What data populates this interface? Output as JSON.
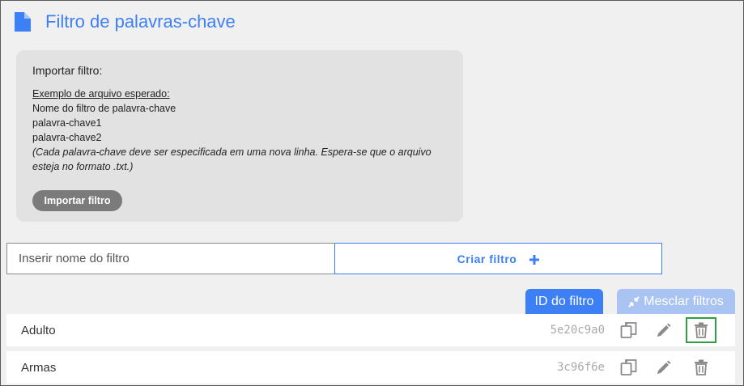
{
  "header": {
    "title": "Filtro de palavras-chave",
    "icon": "document-icon"
  },
  "import_box": {
    "label": "Importar filtro:",
    "example_title": "Exemplo de arquivo esperado:",
    "example_lines": [
      "Nome do filtro de palavra-chave",
      "palavra-chave1",
      "palavra-chave2"
    ],
    "note": "(Cada palavra-chave deve ser especificada em uma nova linha. Espera-se que o arquivo esteja no formato .txt.)",
    "button_label": "Importar filtro"
  },
  "create": {
    "input_placeholder": "Inserir nome do filtro",
    "input_value": "",
    "button_label": "Criar filtro",
    "button_icon": "plus-icon"
  },
  "tabs": {
    "filter_id_label": "ID do filtro",
    "merge_label": "Mesclar filtros",
    "merge_icon": "merge-arrows-icon"
  },
  "filters": [
    {
      "name": "Adulto",
      "id": "5e20c9a0"
    },
    {
      "name": "Armas",
      "id": "3c96f6e"
    }
  ],
  "colors": {
    "accent": "#3d7ff5",
    "accent_light": "#a9c4f3",
    "focus_outline": "#2ea043",
    "icon_gray": "#8a8a8a"
  }
}
